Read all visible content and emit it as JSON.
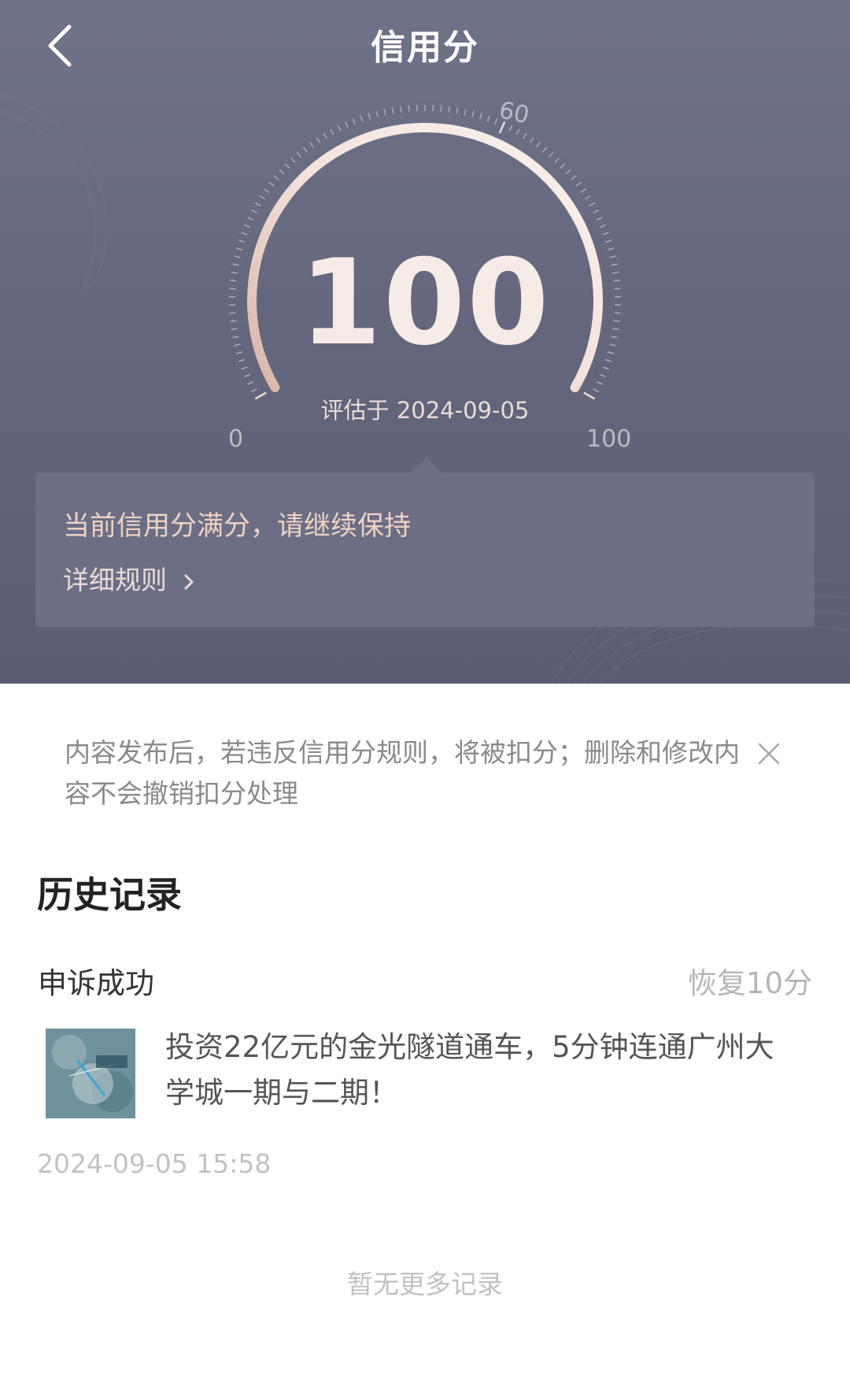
{
  "nav": {
    "title": "信用分"
  },
  "credit": {
    "score": "100",
    "evaluated": "评估于 2024-09-05",
    "gauge_value": 100,
    "gauge_min": 0,
    "gauge_max": 100,
    "tick_min": "0",
    "tick_mid": "60",
    "tick_max": "100"
  },
  "info_card": {
    "message": "当前信用分满分，请继续保持",
    "link_label": "详细规则"
  },
  "notice": {
    "text": "内容发布后，若违反信用分规则，将被扣分；删除和修改内容不会撤销扣分处理"
  },
  "history": {
    "title": "历史记录",
    "records": [
      {
        "status": "申诉成功",
        "delta": "恢复10分",
        "content": "投资22亿元的金光隧道通车，5分钟连通广州大学城一期与二期！",
        "time": "2024-09-05 15:58"
      }
    ],
    "no_more": "暂无更多记录"
  },
  "colors": {
    "hero_bg": "#64677d",
    "card_bg": "#6b6e85",
    "accent_text": "#f0d3c2",
    "score_text": "#f6ebe6"
  }
}
